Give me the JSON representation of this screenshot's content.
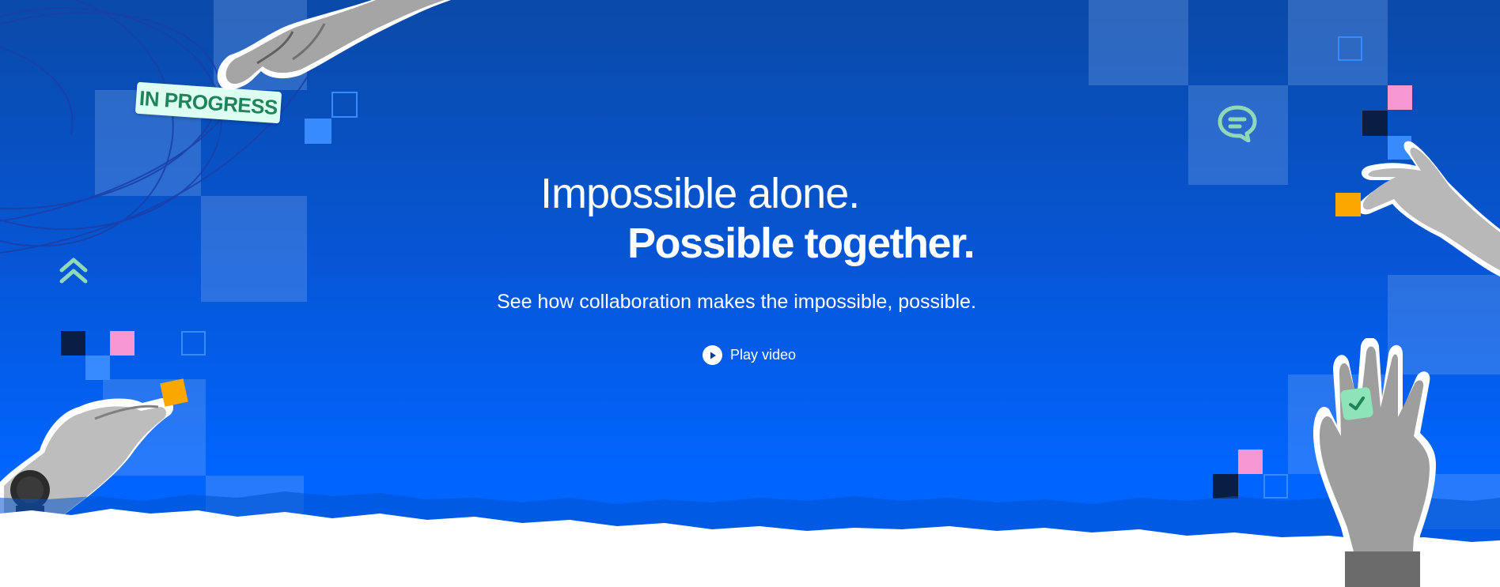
{
  "hero": {
    "headline_line1": "Impossible alone.",
    "headline_line2": "Possible together.",
    "subtitle": "See how collaboration makes the impossible, possible.",
    "play_label": "Play video",
    "badge_label": "IN PROGRESS"
  },
  "icons": {
    "play": "play-icon",
    "chat": "chat-bubble-icon",
    "chevrons": "double-chevron-up-icon",
    "check": "checkmark-icon"
  },
  "colors": {
    "background_top": "#0a4aa8",
    "background_bottom": "#0065ff",
    "accent_green": "#1f845a",
    "accent_pink": "#f797d2",
    "accent_yellow": "#fca700",
    "accent_navy": "#09326c",
    "mint": "#94c748"
  }
}
